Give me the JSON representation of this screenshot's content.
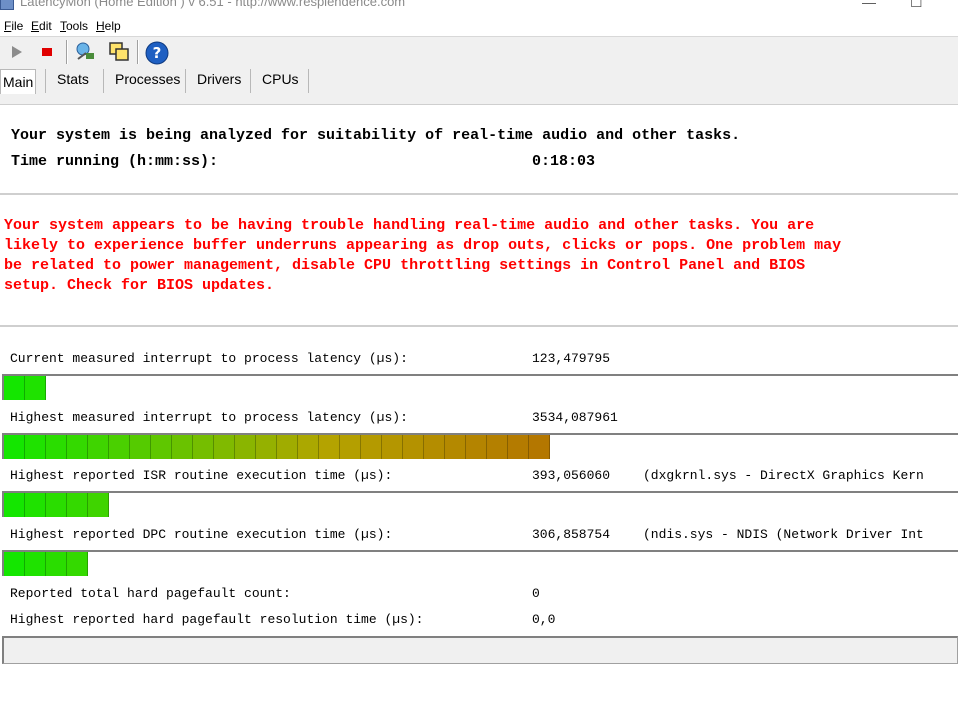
{
  "window": {
    "title": "LatencyMon  (Home Edition )  v 6.51 - http://www.resplendence.com"
  },
  "menu": {
    "items": [
      {
        "label": "File",
        "underline": "F",
        "rest": "ile"
      },
      {
        "label": "Edit",
        "underline": "E",
        "rest": "dit"
      },
      {
        "label": "Tools",
        "underline": "T",
        "rest": "ools"
      },
      {
        "label": "Help",
        "underline": "H",
        "rest": "elp"
      }
    ]
  },
  "toolbar": {
    "icons": [
      "play-icon",
      "stop-icon",
      "explorer-icon",
      "windows-icon",
      "help-icon"
    ],
    "colors": {
      "stop": "#e00000",
      "help": "#1e5fc2"
    }
  },
  "tabs": [
    {
      "label": "Main",
      "active": true
    },
    {
      "label": "Stats",
      "active": false
    },
    {
      "label": "Processes",
      "active": false
    },
    {
      "label": "Drivers",
      "active": false
    },
    {
      "label": "CPUs",
      "active": false
    }
  ],
  "status": {
    "headline": "Your system is being analyzed for suitability of real-time audio and other tasks.",
    "time_label": "Time running (h:mm:ss):",
    "time_value": "0:18:03"
  },
  "warning": {
    "lines": [
      "Your system appears to be having trouble handling real-time audio and other tasks. You are",
      "likely to experience buffer underruns appearing as drop outs, clicks or pops. One problem may",
      "be related to power management, disable CPU throttling settings in Control Panel and BIOS",
      "setup. Check for BIOS updates."
    ],
    "color": "#ff0000"
  },
  "stats": [
    {
      "label": "Current measured interrupt to process latency (µs):",
      "value": "123,479795",
      "extra": "",
      "bar_segments": 2
    },
    {
      "label": "Highest measured interrupt to process latency (µs):",
      "value": "3534,087961",
      "extra": "",
      "bar_segments": 26
    },
    {
      "label": "Highest reported ISR routine execution time (µs):",
      "value": "393,056060",
      "extra": "(dxgkrnl.sys - DirectX Graphics Kern",
      "bar_segments": 5
    },
    {
      "label": "Highest reported DPC routine execution time (µs):",
      "value": "306,858754",
      "extra": "(ndis.sys - NDIS (Network Driver Int",
      "bar_segments": 4
    },
    {
      "label": "Reported total hard pagefault count:",
      "value": "0",
      "extra": ""
    },
    {
      "label": "Highest reported hard pagefault resolution time (µs):",
      "value": "0,0",
      "extra": ""
    }
  ]
}
